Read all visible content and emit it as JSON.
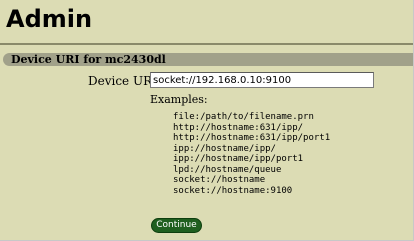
{
  "page": {
    "title": "Admin"
  },
  "section": {
    "title": "Device URI for mc2430dl"
  },
  "form": {
    "uri_label": "Device URI:",
    "uri_value": "socket://192.168.0.10:9100",
    "examples_label": "Examples:",
    "examples": [
      "file:/path/to/filename.prn",
      "http://hostname:631/ipp/",
      "http://hostname:631/ipp/port1",
      "ipp://hostname/ipp/",
      "ipp://hostname/ipp/port1",
      "lpd://hostname/queue",
      "socket://hostname",
      "socket://hostname:9100"
    ],
    "continue_label": "Continue"
  },
  "colors": {
    "background": "#dcdcb4",
    "section_header": "#a1a18a",
    "button": "#1f5f1f"
  }
}
